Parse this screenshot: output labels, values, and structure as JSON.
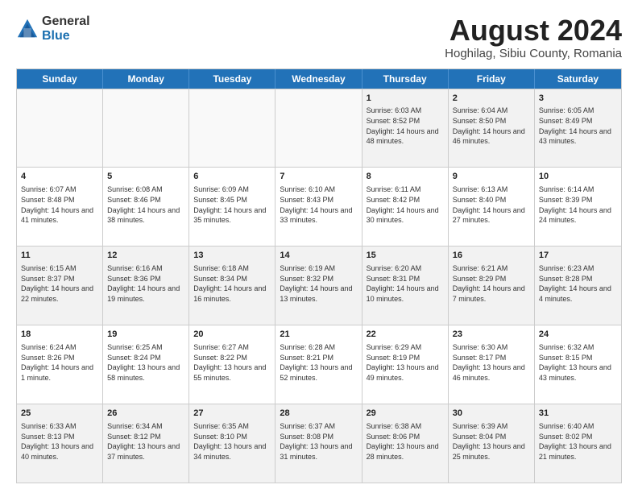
{
  "logo": {
    "general": "General",
    "blue": "Blue"
  },
  "title": "August 2024",
  "location": "Hoghilag, Sibiu County, Romania",
  "days": [
    "Sunday",
    "Monday",
    "Tuesday",
    "Wednesday",
    "Thursday",
    "Friday",
    "Saturday"
  ],
  "rows": [
    [
      {
        "day": "",
        "info": "",
        "empty": true
      },
      {
        "day": "",
        "info": "",
        "empty": true
      },
      {
        "day": "",
        "info": "",
        "empty": true
      },
      {
        "day": "",
        "info": "",
        "empty": true
      },
      {
        "day": "1",
        "info": "Sunrise: 6:03 AM\nSunset: 8:52 PM\nDaylight: 14 hours\nand 48 minutes.",
        "empty": false
      },
      {
        "day": "2",
        "info": "Sunrise: 6:04 AM\nSunset: 8:50 PM\nDaylight: 14 hours\nand 46 minutes.",
        "empty": false
      },
      {
        "day": "3",
        "info": "Sunrise: 6:05 AM\nSunset: 8:49 PM\nDaylight: 14 hours\nand 43 minutes.",
        "empty": false
      }
    ],
    [
      {
        "day": "4",
        "info": "Sunrise: 6:07 AM\nSunset: 8:48 PM\nDaylight: 14 hours\nand 41 minutes.",
        "empty": false
      },
      {
        "day": "5",
        "info": "Sunrise: 6:08 AM\nSunset: 8:46 PM\nDaylight: 14 hours\nand 38 minutes.",
        "empty": false
      },
      {
        "day": "6",
        "info": "Sunrise: 6:09 AM\nSunset: 8:45 PM\nDaylight: 14 hours\nand 35 minutes.",
        "empty": false
      },
      {
        "day": "7",
        "info": "Sunrise: 6:10 AM\nSunset: 8:43 PM\nDaylight: 14 hours\nand 33 minutes.",
        "empty": false
      },
      {
        "day": "8",
        "info": "Sunrise: 6:11 AM\nSunset: 8:42 PM\nDaylight: 14 hours\nand 30 minutes.",
        "empty": false
      },
      {
        "day": "9",
        "info": "Sunrise: 6:13 AM\nSunset: 8:40 PM\nDaylight: 14 hours\nand 27 minutes.",
        "empty": false
      },
      {
        "day": "10",
        "info": "Sunrise: 6:14 AM\nSunset: 8:39 PM\nDaylight: 14 hours\nand 24 minutes.",
        "empty": false
      }
    ],
    [
      {
        "day": "11",
        "info": "Sunrise: 6:15 AM\nSunset: 8:37 PM\nDaylight: 14 hours\nand 22 minutes.",
        "empty": false
      },
      {
        "day": "12",
        "info": "Sunrise: 6:16 AM\nSunset: 8:36 PM\nDaylight: 14 hours\nand 19 minutes.",
        "empty": false
      },
      {
        "day": "13",
        "info": "Sunrise: 6:18 AM\nSunset: 8:34 PM\nDaylight: 14 hours\nand 16 minutes.",
        "empty": false
      },
      {
        "day": "14",
        "info": "Sunrise: 6:19 AM\nSunset: 8:32 PM\nDaylight: 14 hours\nand 13 minutes.",
        "empty": false
      },
      {
        "day": "15",
        "info": "Sunrise: 6:20 AM\nSunset: 8:31 PM\nDaylight: 14 hours\nand 10 minutes.",
        "empty": false
      },
      {
        "day": "16",
        "info": "Sunrise: 6:21 AM\nSunset: 8:29 PM\nDaylight: 14 hours\nand 7 minutes.",
        "empty": false
      },
      {
        "day": "17",
        "info": "Sunrise: 6:23 AM\nSunset: 8:28 PM\nDaylight: 14 hours\nand 4 minutes.",
        "empty": false
      }
    ],
    [
      {
        "day": "18",
        "info": "Sunrise: 6:24 AM\nSunset: 8:26 PM\nDaylight: 14 hours\nand 1 minute.",
        "empty": false
      },
      {
        "day": "19",
        "info": "Sunrise: 6:25 AM\nSunset: 8:24 PM\nDaylight: 13 hours\nand 58 minutes.",
        "empty": false
      },
      {
        "day": "20",
        "info": "Sunrise: 6:27 AM\nSunset: 8:22 PM\nDaylight: 13 hours\nand 55 minutes.",
        "empty": false
      },
      {
        "day": "21",
        "info": "Sunrise: 6:28 AM\nSunset: 8:21 PM\nDaylight: 13 hours\nand 52 minutes.",
        "empty": false
      },
      {
        "day": "22",
        "info": "Sunrise: 6:29 AM\nSunset: 8:19 PM\nDaylight: 13 hours\nand 49 minutes.",
        "empty": false
      },
      {
        "day": "23",
        "info": "Sunrise: 6:30 AM\nSunset: 8:17 PM\nDaylight: 13 hours\nand 46 minutes.",
        "empty": false
      },
      {
        "day": "24",
        "info": "Sunrise: 6:32 AM\nSunset: 8:15 PM\nDaylight: 13 hours\nand 43 minutes.",
        "empty": false
      }
    ],
    [
      {
        "day": "25",
        "info": "Sunrise: 6:33 AM\nSunset: 8:13 PM\nDaylight: 13 hours\nand 40 minutes.",
        "empty": false
      },
      {
        "day": "26",
        "info": "Sunrise: 6:34 AM\nSunset: 8:12 PM\nDaylight: 13 hours\nand 37 minutes.",
        "empty": false
      },
      {
        "day": "27",
        "info": "Sunrise: 6:35 AM\nSunset: 8:10 PM\nDaylight: 13 hours\nand 34 minutes.",
        "empty": false
      },
      {
        "day": "28",
        "info": "Sunrise: 6:37 AM\nSunset: 8:08 PM\nDaylight: 13 hours\nand 31 minutes.",
        "empty": false
      },
      {
        "day": "29",
        "info": "Sunrise: 6:38 AM\nSunset: 8:06 PM\nDaylight: 13 hours\nand 28 minutes.",
        "empty": false
      },
      {
        "day": "30",
        "info": "Sunrise: 6:39 AM\nSunset: 8:04 PM\nDaylight: 13 hours\nand 25 minutes.",
        "empty": false
      },
      {
        "day": "31",
        "info": "Sunrise: 6:40 AM\nSunset: 8:02 PM\nDaylight: 13 hours\nand 21 minutes.",
        "empty": false
      }
    ]
  ]
}
